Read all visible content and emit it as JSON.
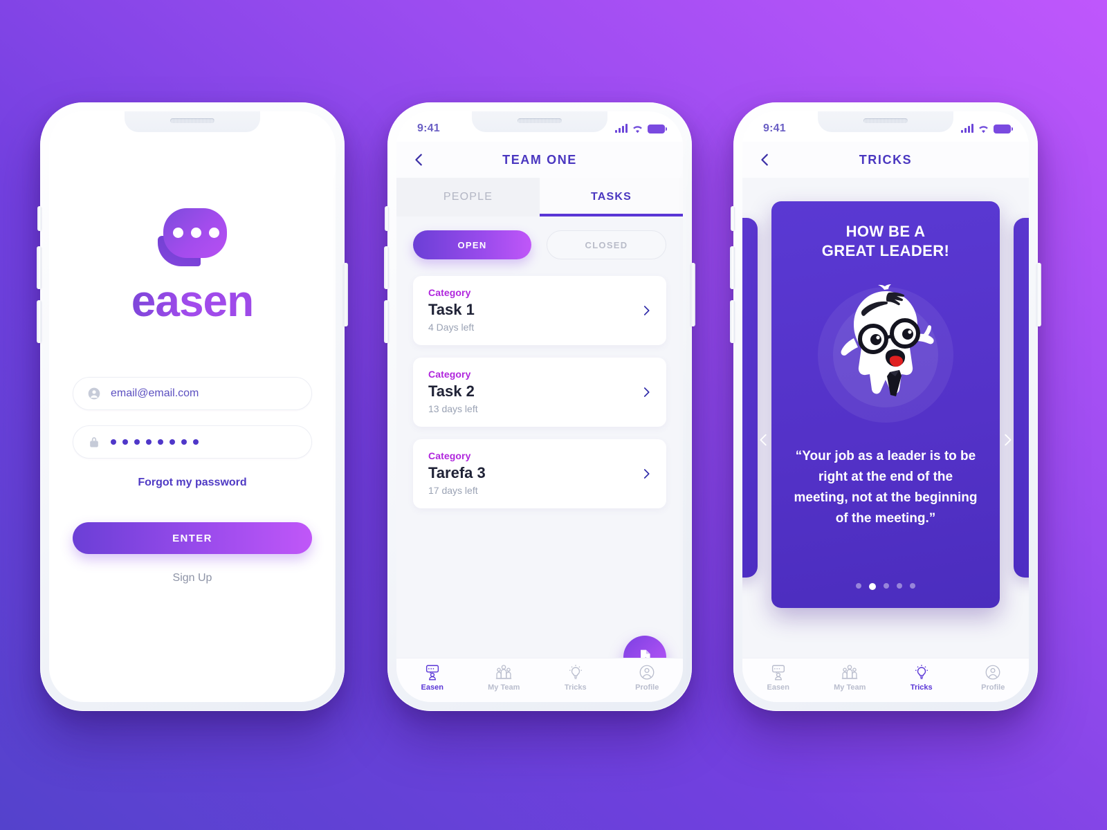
{
  "theme": {
    "bg_gradient_from": "#5442CC",
    "bg_gradient_to": "#BF57FC",
    "accent": "#5A36D6",
    "accent_magenta": "#B026DD"
  },
  "login": {
    "brand": "easen",
    "email": {
      "value": "email@email.com",
      "placeholder": "email@email.com"
    },
    "password": {
      "value": "••••••••",
      "dots": 8
    },
    "forgot_label": "Forgot my password",
    "enter_label": "ENTER",
    "signup_label": "Sign Up"
  },
  "team": {
    "status": {
      "time": "9:41"
    },
    "title": "TEAM ONE",
    "tabs": [
      {
        "label": "PEOPLE",
        "active": false
      },
      {
        "label": "TASKS",
        "active": true
      }
    ],
    "filters": [
      {
        "label": "OPEN",
        "active": true
      },
      {
        "label": "CLOSED",
        "active": false
      }
    ],
    "tasks": [
      {
        "category": "Category",
        "name": "Task 1",
        "due": "4 Days left"
      },
      {
        "category": "Category",
        "name": "Task 2",
        "due": "13 days left"
      },
      {
        "category": "Category",
        "name": "Tarefa 3",
        "due": "17 days left"
      }
    ],
    "nav": [
      {
        "label": "Easen",
        "icon": "chat-person-icon",
        "active": true
      },
      {
        "label": "My Team",
        "icon": "people-group-icon",
        "active": false
      },
      {
        "label": "Tricks",
        "icon": "lightbulb-icon",
        "active": false
      },
      {
        "label": "Profile",
        "icon": "user-circle-icon",
        "active": false
      }
    ]
  },
  "tricks": {
    "status": {
      "time": "9:41"
    },
    "title": "TRICKS",
    "card": {
      "heading_line1": "HOW BE A",
      "heading_line2": "GREAT LEADER!",
      "quote": "“Your job as a leader is to be right at the end of the meeting, not at the beginning of the meeting.”",
      "pagination": {
        "total": 5,
        "active_index": 1
      }
    },
    "nav": [
      {
        "label": "Easen",
        "icon": "chat-person-icon",
        "active": false
      },
      {
        "label": "My Team",
        "icon": "people-group-icon",
        "active": false
      },
      {
        "label": "Tricks",
        "icon": "lightbulb-icon",
        "active": true
      },
      {
        "label": "Profile",
        "icon": "user-circle-icon",
        "active": false
      }
    ]
  }
}
